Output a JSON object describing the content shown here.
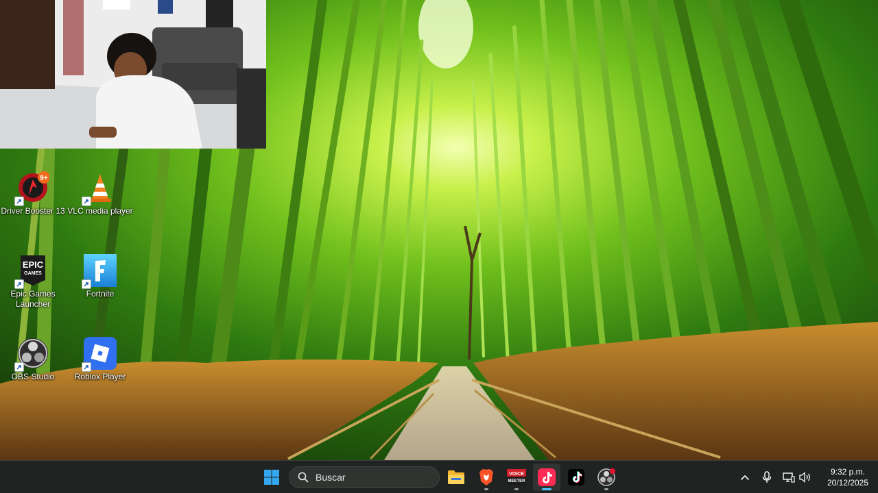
{
  "desktop": {
    "icons": [
      {
        "label": "Driver Booster 13",
        "icon": "driver-booster-icon",
        "badge": "9+"
      },
      {
        "label": "VLC media player",
        "icon": "vlc-icon"
      },
      {
        "label": "Epic Games Launcher",
        "icon": "epic-games-icon",
        "logo_text": "EPIC GAMES"
      },
      {
        "label": "Fortnite",
        "icon": "fortnite-icon",
        "logo_text": "F"
      },
      {
        "label": "OBS Studio",
        "icon": "obs-icon"
      },
      {
        "label": "Roblox Player",
        "icon": "roblox-icon"
      }
    ]
  },
  "taskbar": {
    "search_placeholder": "Buscar",
    "apps": [
      {
        "name": "Start",
        "icon": "windows-start-icon"
      },
      {
        "name": "File Explorer",
        "icon": "folder-icon"
      },
      {
        "name": "Brave",
        "icon": "brave-icon"
      },
      {
        "name": "Voicemeeter",
        "icon": "voicemeeter-icon",
        "logo_text": "VOICE MEETER"
      },
      {
        "name": "TikTok LIVE Studio",
        "icon": "tiktok-live-icon",
        "active": true
      },
      {
        "name": "TikTok",
        "icon": "tiktok-icon"
      },
      {
        "name": "OBS Studio",
        "icon": "obs-icon",
        "notification": true
      }
    ],
    "tray": {
      "icons": [
        "chevron-up-icon",
        "microphone-icon",
        "network-icon",
        "volume-icon"
      ]
    },
    "clock": {
      "time": "9:32 p.m.",
      "date": "20/12/2025"
    }
  },
  "colors": {
    "taskbar_bg": "#1f2321",
    "accent": "#4cc2ff",
    "windows_blue": "#34a6f0"
  }
}
